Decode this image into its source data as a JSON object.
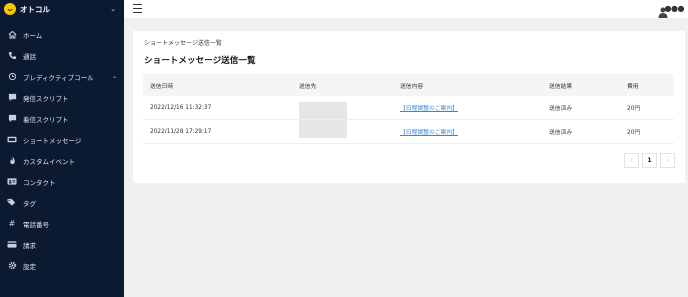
{
  "app": {
    "brand_name": "オトコル",
    "logo_text": "ᴗ"
  },
  "sidebar": {
    "items": [
      {
        "label": "ホーム",
        "icon": "home-icon"
      },
      {
        "label": "通話",
        "icon": "phone-icon"
      },
      {
        "label": "プレディクティブコール",
        "icon": "predictive-call-icon",
        "expandable": true
      },
      {
        "label": "発信スクリプト",
        "icon": "outgoing-script-icon"
      },
      {
        "label": "着信スクリプト",
        "icon": "incoming-script-icon"
      },
      {
        "label": "ショートメッセージ",
        "icon": "sms-icon"
      },
      {
        "label": "カスタムイベント",
        "icon": "flame-icon"
      },
      {
        "label": "コンタクト",
        "icon": "contact-card-icon"
      },
      {
        "label": "タグ",
        "icon": "tag-icon"
      },
      {
        "label": "電話番号",
        "icon": "hash-icon"
      },
      {
        "label": "請求",
        "icon": "credit-card-icon"
      },
      {
        "label": "設定",
        "icon": "gear-icon"
      }
    ]
  },
  "main": {
    "breadcrumb": "ショートメッセージ送信一覧",
    "title": "ショートメッセージ送信一覧",
    "table": {
      "columns": [
        "送信日時",
        "送信先",
        "送信内容",
        "送信結果",
        "費用"
      ],
      "rows": [
        {
          "datetime": "2022/12/16 11:32:37",
          "destination": "",
          "content": "【日程調整のご案内】",
          "result": "送信済み",
          "cost": "20円"
        },
        {
          "datetime": "2022/11/28 17:29:17",
          "destination": "",
          "content": "【日程調整のご案内】",
          "result": "送信済み",
          "cost": "20円"
        }
      ]
    },
    "pagination": {
      "prev": "‹",
      "current": "1",
      "next": "›"
    }
  },
  "colors": {
    "sidebar_bg": "#0b1931",
    "link": "#3a86d6",
    "page_bg": "#f0f0f2"
  }
}
